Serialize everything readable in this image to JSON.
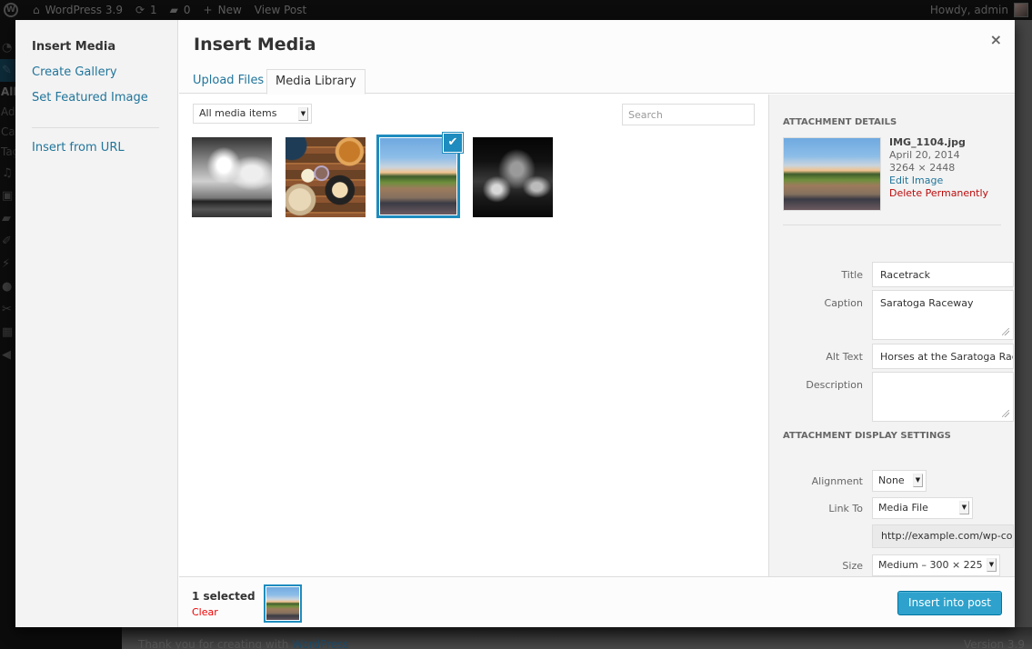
{
  "adminbar": {
    "site_name": "WordPress 3.9",
    "updates_count": "1",
    "comments_count": "0",
    "new_label": "New",
    "view_post_label": "View Post",
    "howdy": "Howdy, admin",
    "icons": {
      "logo": "wordpress-logo-icon",
      "home": "home-icon",
      "updates": "refresh-icon",
      "comments": "comment-icon",
      "new": "plus-icon"
    }
  },
  "admin_menu": {
    "submenu": [
      "All",
      "Add",
      "Cat",
      "Tag"
    ]
  },
  "footer": {
    "thanks_prefix": "Thank you for creating with ",
    "thanks_link": "WordPress",
    "version": "Version 3.9"
  },
  "modal": {
    "menu": {
      "items": [
        {
          "label": "Insert Media",
          "active": true
        },
        {
          "label": "Create Gallery",
          "active": false
        },
        {
          "label": "Set Featured Image",
          "active": false
        },
        {
          "label": "Insert from URL",
          "active": false
        }
      ]
    },
    "title": "Insert Media",
    "close_icon": "×",
    "tabs": [
      {
        "label": "Upload Files",
        "active": false
      },
      {
        "label": "Media Library",
        "active": true
      }
    ],
    "filter": {
      "selected": "All media items",
      "arrow": "▼"
    },
    "search": {
      "placeholder": "Search",
      "value": ""
    },
    "attachments": [
      {
        "name": "clouds-bw",
        "selected": false
      },
      {
        "name": "tea-table",
        "selected": false
      },
      {
        "name": "racetrack",
        "selected": true
      },
      {
        "name": "night-building-bw",
        "selected": false
      }
    ],
    "check_icon": "✔",
    "details": {
      "heading": "Attachment Details",
      "filename": "IMG_1104.jpg",
      "date": "April 20, 2014",
      "dimensions": "3264 × 2448",
      "edit_link": "Edit Image",
      "delete_link": "Delete Permanently",
      "fields": {
        "title_label": "Title",
        "title_value": "Racetrack",
        "caption_label": "Caption",
        "caption_value": "Saratoga Raceway",
        "alt_label": "Alt Text",
        "alt_value": "Horses at the Saratoga Race",
        "description_label": "Description",
        "description_value": ""
      }
    },
    "display_settings": {
      "heading": "Attachment Display Settings",
      "alignment_label": "Alignment",
      "alignment_value": "None",
      "link_label": "Link To",
      "link_value": "Media File",
      "url_value": "http://example.com/wp-con",
      "size_label": "Size",
      "size_value": "Medium – 300 × 225",
      "arrow": "▼"
    },
    "toolbar": {
      "selected_count": "1 selected",
      "clear_label": "Clear",
      "insert_label": "Insert into post"
    }
  }
}
